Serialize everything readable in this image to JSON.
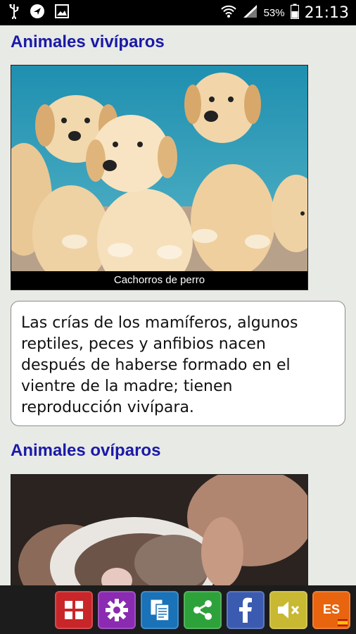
{
  "status_bar": {
    "battery_percent": "53%",
    "time": "21:13"
  },
  "sections": {
    "viviparous_title": "Animales vivíparos",
    "puppies_caption": "Cachorros de perro",
    "viviparous_text": "Las crías de los mamíferos, algunos reptiles, peces y anfibios nacen después de haberse formado en el vientre de la madre; tienen reproducción vivípara.",
    "oviparous_title": "Animales ovíparos"
  },
  "toolbar": {
    "lang_label": "ES",
    "buttons": [
      "menu-grid-icon",
      "gear-icon",
      "copy-icon",
      "share-icon",
      "facebook-icon",
      "sound-off-icon",
      "language-icon"
    ]
  },
  "colors": {
    "title_blue": "#1a1aa6",
    "bottombar": "#1c1c1c"
  }
}
